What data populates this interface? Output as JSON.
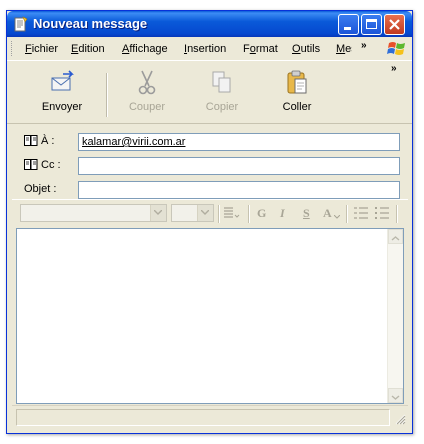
{
  "window": {
    "title": "Nouveau message"
  },
  "menu": {
    "items": [
      {
        "label": "Fichier",
        "ul": "F",
        "rest": "ichier"
      },
      {
        "label": "Edition",
        "ul": "E",
        "rest": "dition"
      },
      {
        "label": "Affichage",
        "ul": "A",
        "rest": "ffichage"
      },
      {
        "label": "Insertion",
        "ul": "I",
        "rest": "nsertion"
      },
      {
        "label": "Format",
        "pre": "F",
        "ul": "o",
        "rest": "rmat"
      },
      {
        "label": "Outils",
        "ul": "O",
        "rest": "utils"
      },
      {
        "label": "Mes",
        "ul": "M",
        "rest": "es"
      }
    ],
    "overflow": "»"
  },
  "toolbar": {
    "overflow": "»",
    "send": "Envoyer",
    "cut": "Couper",
    "copy": "Copier",
    "paste": "Coller"
  },
  "fields": {
    "to_label": "À :",
    "to_value": "kalamar@virii.com.ar",
    "cc_label": "Cc :",
    "cc_value": "",
    "subject_label": "Objet :",
    "subject_value": ""
  },
  "format": {
    "font": "",
    "size": "",
    "bold": "G",
    "italic": "I",
    "underline": "S",
    "color": "A"
  },
  "colors": {
    "titlebar": "#0a5ad9",
    "chrome": "#ece9d8",
    "input_border": "#7f9db9",
    "disabled": "#a8a596"
  }
}
